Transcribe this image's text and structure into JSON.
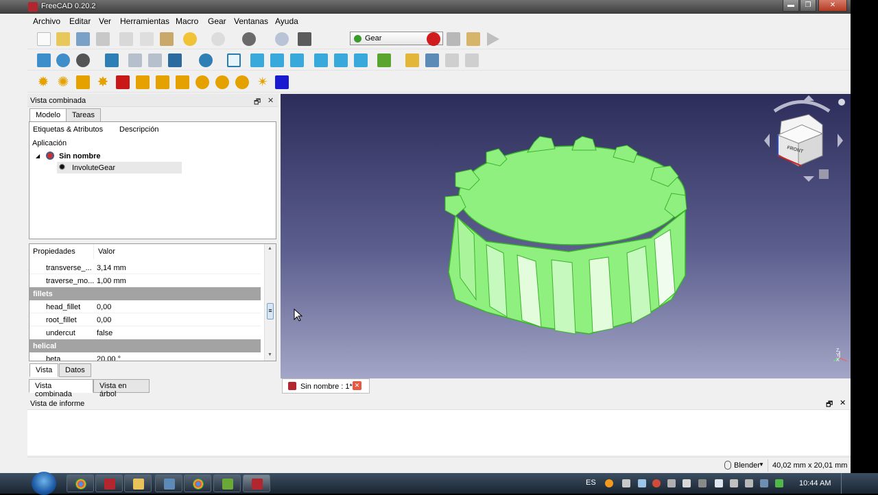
{
  "window": {
    "title": "FreeCAD 0.20.2",
    "min_glyph": "▬",
    "max_glyph": "❐",
    "close_glyph": "✕"
  },
  "menu": [
    "Archivo",
    "Editar",
    "Ver",
    "Herramientas",
    "Macro",
    "Gear",
    "Ventanas",
    "Ayuda"
  ],
  "toolbar": {
    "workbench": "Gear"
  },
  "combo_view": {
    "title": "Vista combinada",
    "float_glyph": "🗗",
    "close_glyph": "✕",
    "tabs": [
      "Modelo",
      "Tareas"
    ],
    "tree": {
      "col_labels": "Etiquetas & Atributos",
      "col_desc": "Descripción",
      "root": "Aplicación",
      "doc": "Sin nombre",
      "object": "InvoluteGear",
      "expand_glyph": "◢"
    },
    "props": {
      "col_prop": "Propiedades",
      "col_val": "Valor",
      "rows": [
        {
          "type": "row",
          "k": "transverse_...",
          "v": "3,14 mm"
        },
        {
          "type": "row",
          "k": "traverse_mo...",
          "v": "1,00 mm"
        },
        {
          "type": "group",
          "k": "fillets"
        },
        {
          "type": "row",
          "k": "head_fillet",
          "v": "0,00"
        },
        {
          "type": "row",
          "k": "root_fillet",
          "v": "0,00"
        },
        {
          "type": "row",
          "k": "undercut",
          "v": "false"
        },
        {
          "type": "group",
          "k": "helical"
        },
        {
          "type": "row",
          "k": "beta",
          "v": "20,00 °"
        }
      ],
      "scroll_up": "▲",
      "scroll_down": "▼",
      "grip": "≡"
    },
    "bottom_tabs": [
      "Vista",
      "Datos"
    ],
    "view_tabs": [
      "Vista combinada",
      "Vista en árbol"
    ]
  },
  "viewport": {
    "doc_tab": "Sin nombre : 1*",
    "navcube_face": "FRONT",
    "axis_label": "Z\nY\nX"
  },
  "report": {
    "title": "Vista de informe",
    "float_glyph": "🗗",
    "close_glyph": "✕"
  },
  "statusbar": {
    "nav_style": "Blender",
    "nav_arrow": "▼",
    "dimensions": "40,02 mm x 20,01 mm"
  },
  "taskbar": {
    "lang": "ES",
    "clock": "10:44 AM"
  },
  "colors": {
    "gear_fill": "#8ff07f",
    "gear_stroke": "#3ab42a",
    "record": "#d01c1c"
  }
}
